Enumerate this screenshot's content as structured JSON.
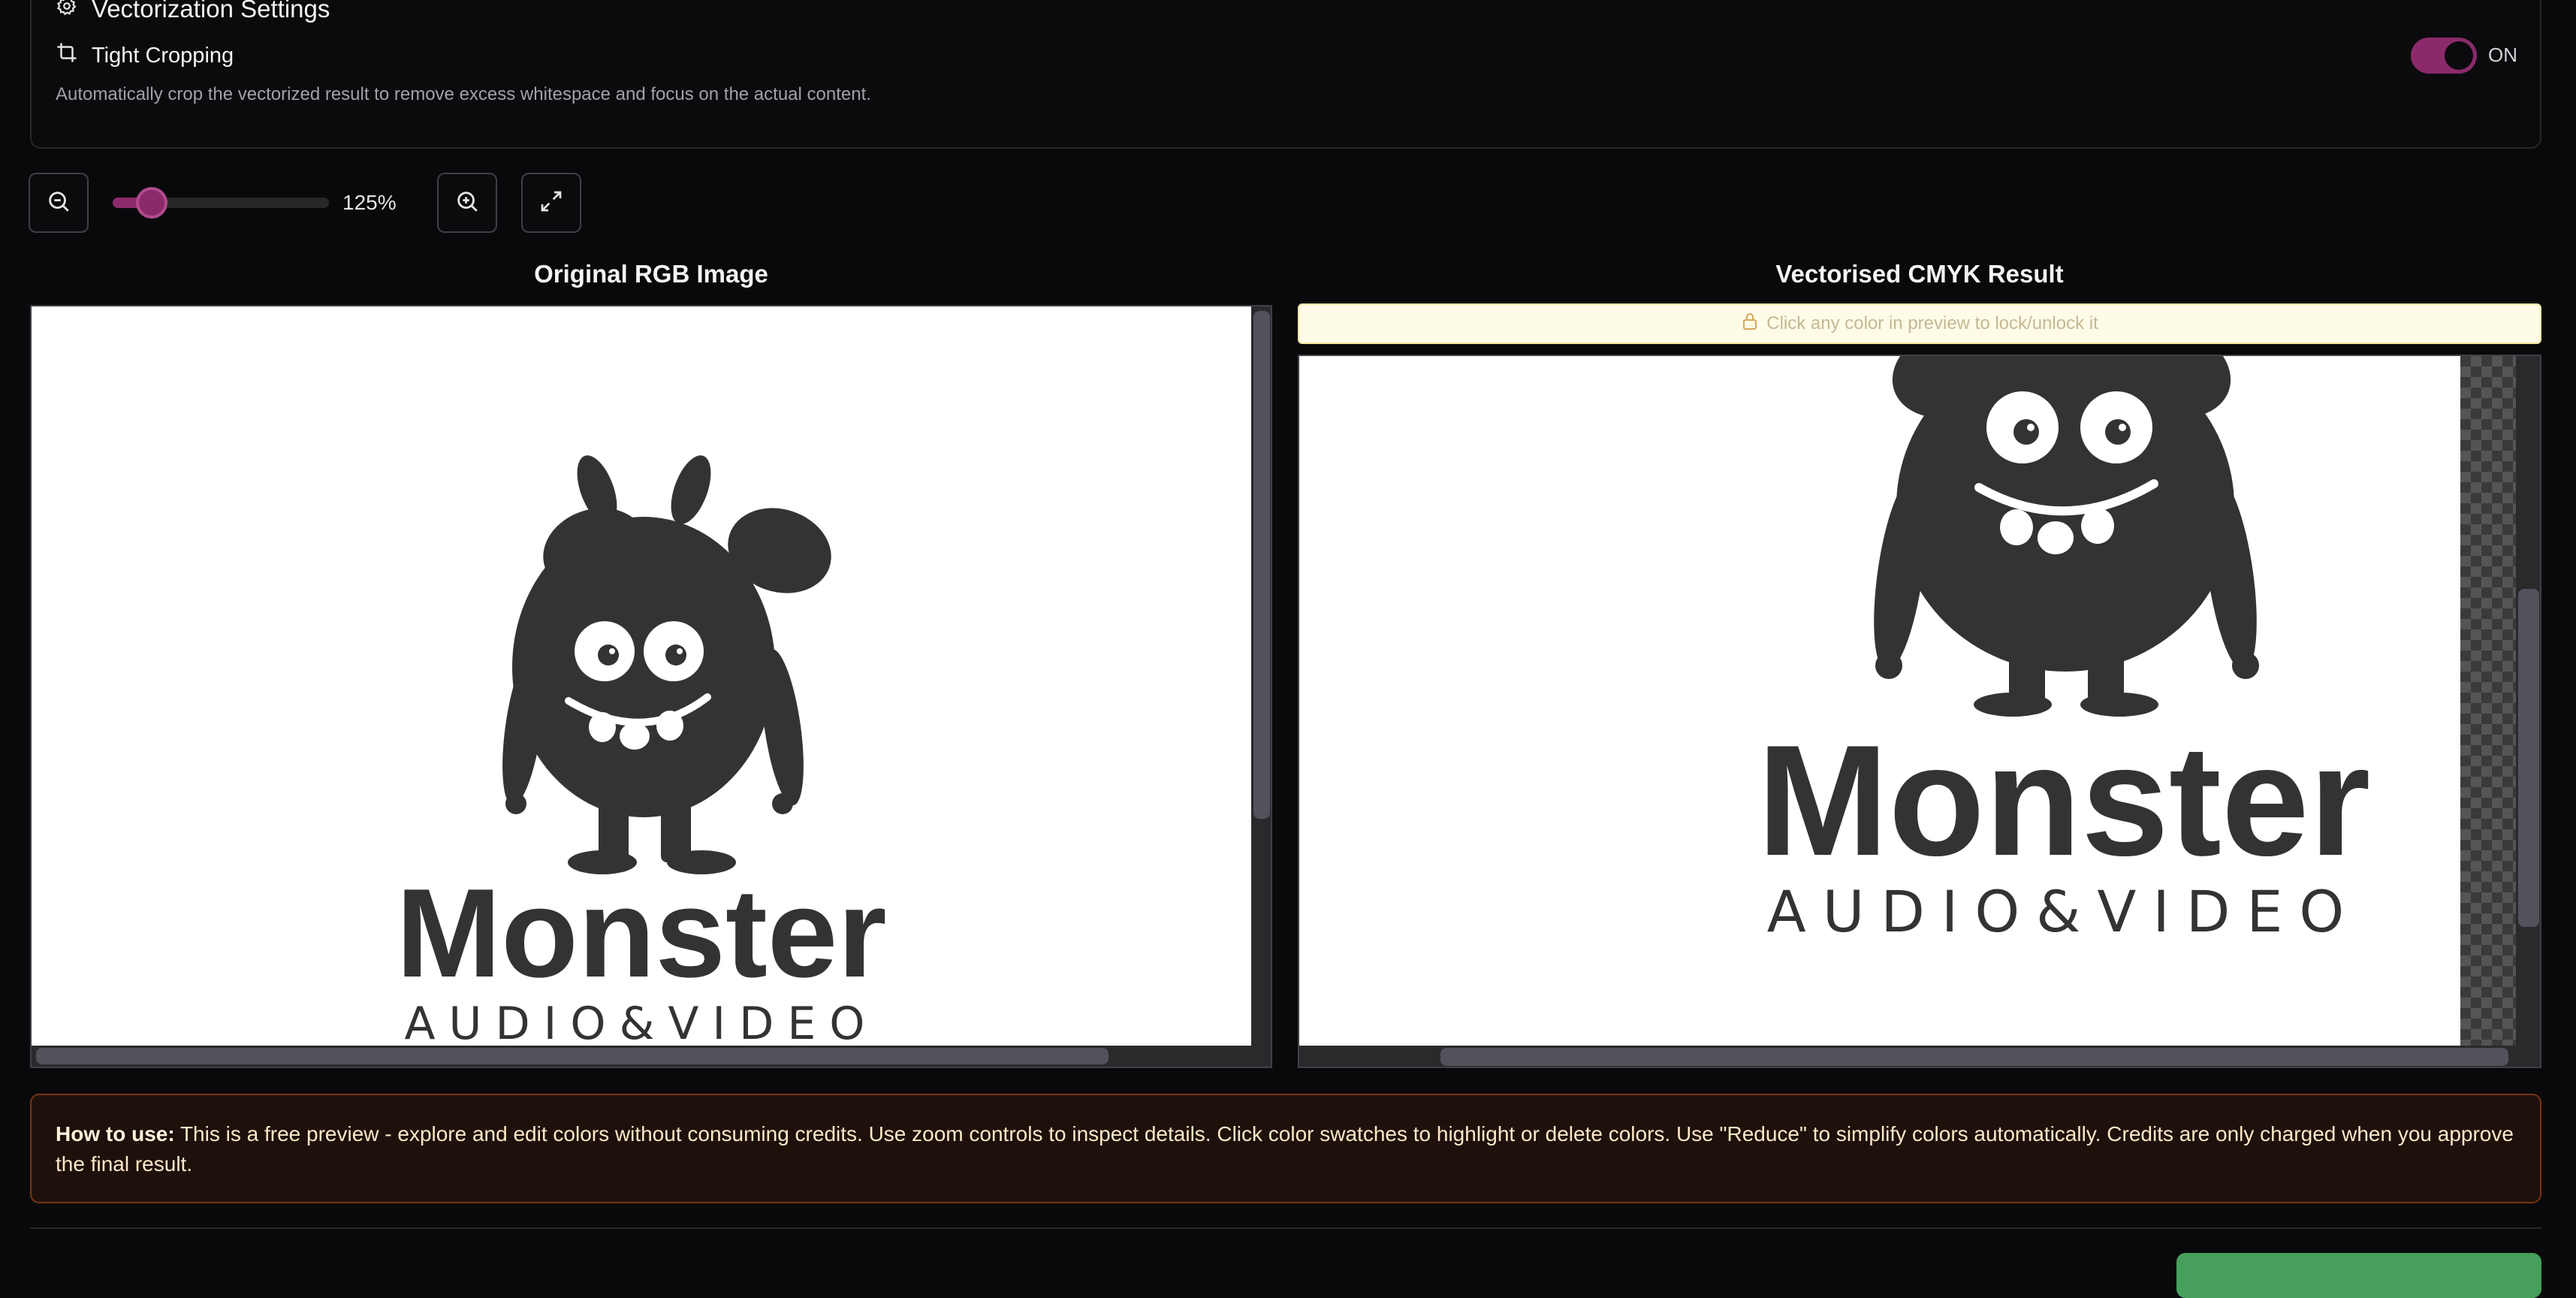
{
  "settings": {
    "title": "Vectorization Settings",
    "tight_cropping_label": "Tight Cropping",
    "tight_cropping_description": "Automatically crop the vectorized result to remove excess whitespace and focus on the actual content.",
    "toggle_state": "ON",
    "toggle_on": true
  },
  "zoom": {
    "readout": "125%",
    "slider_fraction": 0.18
  },
  "panels": {
    "original_title": "Original RGB Image",
    "result_title": "Vectorised CMYK Result",
    "lock_hint": "Click any color in preview to lock/unlock it"
  },
  "logo": {
    "word": "Monster",
    "tagline": "AUDIO&VIDEO"
  },
  "howto": {
    "label": "How to use:",
    "text": "This is a free preview - explore and edit colors without consuming credits. Use zoom controls to inspect details. Click color swatches to highlight or delete colors. Use \"Reduce\" to simplify colors automatically. Credits are only charged when you approve the final result."
  },
  "colors": {
    "accent": "#8b2a6b",
    "logo_fill": "#333333",
    "approve_green": "#46a05b",
    "howto_border": "#7a3413"
  },
  "icons": {
    "settings": "gear-icon",
    "crop": "crop-icon",
    "zoom_out": "zoom-out-icon",
    "zoom_in": "zoom-in-icon",
    "fit": "expand-icon",
    "lock": "lock-icon"
  }
}
